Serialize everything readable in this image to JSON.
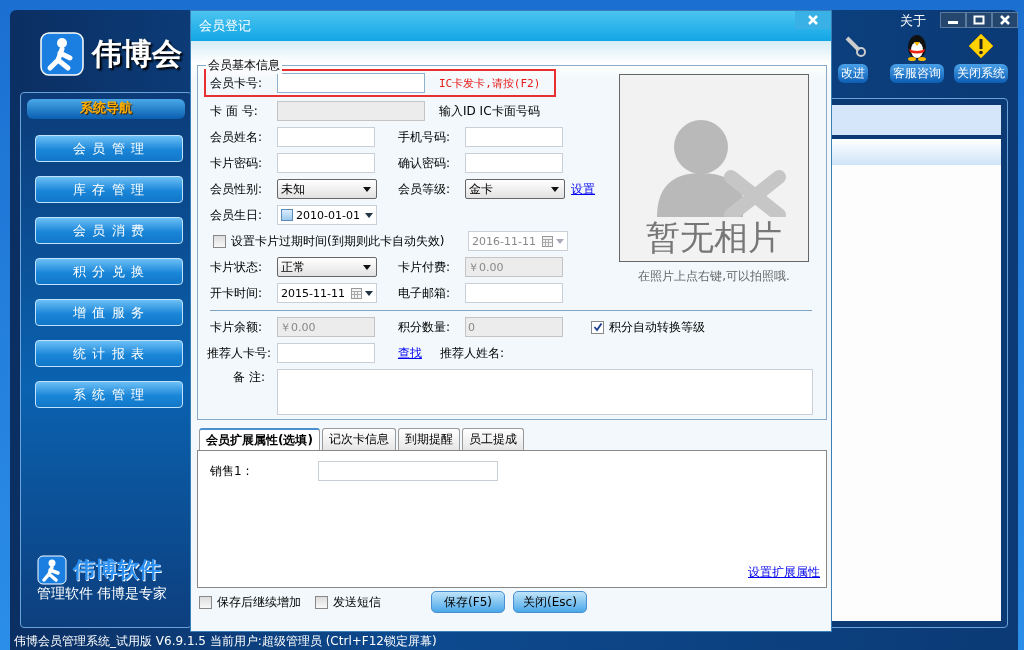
{
  "app": {
    "title": "伟博会",
    "about": "关于",
    "toolbar": [
      {
        "kind": "wrench",
        "label": "改进"
      },
      {
        "kind": "penguin",
        "label": "客服咨询"
      },
      {
        "kind": "warning",
        "label": "关闭系统"
      }
    ],
    "nav_title": "系统导航",
    "nav": [
      "会 员 管 理",
      "库 存 管 理",
      "会 员 消 费",
      "积 分 兑 换",
      "增 值 服 务",
      "统 计 报 表",
      "系 统 管 理"
    ],
    "brand": "伟博软件",
    "slogan": "管理软件 伟博是专家",
    "status": "伟博会员管理系统_试用版 V6.9.1.5 当前用户:超级管理员 (Ctrl+F12锁定屏幕)"
  },
  "dialog": {
    "title": "会员登记",
    "group_title": "会员基本信息",
    "rows": [
      {
        "kind": "hinted",
        "label": "会员卡号:",
        "field": {
          "kind": "input",
          "disabled": false
        },
        "hint": "IC卡发卡,请按(F2)",
        "highlighted": true
      },
      {
        "kind": "hinted",
        "label": "卡 面 号:",
        "field": {
          "kind": "input",
          "disabled": true
        },
        "hint": "输入ID IC卡面号码",
        "highlighted": false
      },
      {
        "kind": "pair",
        "cells": [
          {
            "label": "会员姓名:",
            "field": {
              "kind": "input",
              "disabled": false
            }
          },
          {
            "label": "手机号码:",
            "field": {
              "kind": "input",
              "disabled": false
            }
          }
        ]
      },
      {
        "kind": "pair",
        "cells": [
          {
            "label": "卡片密码:",
            "field": {
              "kind": "input",
              "disabled": false
            }
          },
          {
            "label": "确认密码:",
            "field": {
              "kind": "input",
              "disabled": false
            }
          }
        ]
      },
      {
        "kind": "pair",
        "cells": [
          {
            "label": "会员性别:",
            "field": {
              "kind": "select",
              "value": "未知"
            }
          },
          {
            "label": "会员等级:",
            "field": {
              "kind": "select",
              "value": "金卡"
            },
            "link": "设置"
          }
        ]
      },
      {
        "kind": "pair",
        "cells": [
          {
            "label": "会员生日:",
            "field": {
              "kind": "date",
              "value": "2010-01-01",
              "checked": false,
              "disabled": false
            }
          }
        ]
      },
      {
        "kind": "check",
        "label": "设置卡片过期时间(到期则此卡自动失效)",
        "checked": false,
        "field": {
          "kind": "date",
          "value": "2016-11-11",
          "disabled": true
        }
      },
      {
        "kind": "pair",
        "cells": [
          {
            "label": "卡片状态:",
            "field": {
              "kind": "select",
              "value": "正常"
            }
          },
          {
            "label": "卡片付费:",
            "field": {
              "kind": "input",
              "value": "￥0.00",
              "disabled": true
            }
          }
        ]
      },
      {
        "kind": "pair",
        "cells": [
          {
            "label": "开卡时间:",
            "field": {
              "kind": "date",
              "value": "2015-11-11",
              "disabled": false
            }
          },
          {
            "label": "电子邮箱:",
            "field": {
              "kind": "input",
              "disabled": false
            }
          }
        ]
      }
    ],
    "photo": {
      "caption": "暂无相片",
      "hint": "在照片上点右键,可以拍照哦."
    },
    "lower_rows": [
      {
        "kind": "pair",
        "cells": [
          {
            "label": "卡片余额:",
            "field": {
              "kind": "input",
              "value": "￥0.00",
              "disabled": true
            }
          },
          {
            "label": "积分数量:",
            "field": {
              "kind": "input",
              "value": "0",
              "disabled": true
            }
          }
        ],
        "option": {
          "label": "积分自动转换等级",
          "checked": true
        }
      },
      {
        "kind": "pair",
        "cells": [
          {
            "label": "推荐人卡号:",
            "field": {
              "kind": "input",
              "disabled": false
            }
          },
          {
            "lookup": "查找",
            "label": "推荐人姓名:"
          }
        ]
      },
      {
        "kind": "notes",
        "label": "备 注:"
      }
    ],
    "tabs": [
      {
        "label": "会员扩展属性(选填)",
        "selected": true
      },
      {
        "label": "记次卡信息",
        "selected": false
      },
      {
        "label": "到期提醒",
        "selected": false
      },
      {
        "label": "员工提成",
        "selected": false
      }
    ],
    "tab_fields": [
      {
        "label": "销售1 :"
      }
    ],
    "tab_link": "设置扩展属性",
    "options": [
      {
        "label": "保存后继续增加",
        "checked": false
      },
      {
        "label": "发送短信",
        "checked": false
      }
    ],
    "buttons": [
      "保存(F5)",
      "关闭(Esc)"
    ]
  }
}
